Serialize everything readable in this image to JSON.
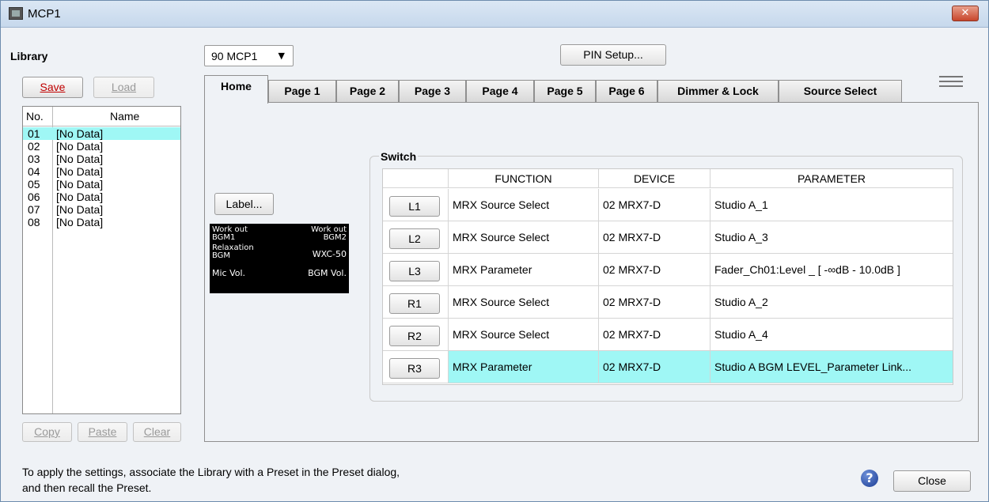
{
  "window": {
    "title": "MCP1",
    "close_glyph": "✕"
  },
  "library": {
    "heading": "Library",
    "save_label": "Save",
    "load_label": "Load",
    "copy_label": "Copy",
    "paste_label": "Paste",
    "clear_label": "Clear",
    "col_no": "No.",
    "col_name": "Name",
    "rows": [
      {
        "no": "01",
        "name": "[No Data]"
      },
      {
        "no": "02",
        "name": "[No Data]"
      },
      {
        "no": "03",
        "name": "[No Data]"
      },
      {
        "no": "04",
        "name": "[No Data]"
      },
      {
        "no": "05",
        "name": "[No Data]"
      },
      {
        "no": "06",
        "name": "[No Data]"
      },
      {
        "no": "07",
        "name": "[No Data]"
      },
      {
        "no": "08",
        "name": "[No Data]"
      }
    ],
    "selected_index": 0
  },
  "device_select": {
    "value": "90 MCP1",
    "arrow": "▼"
  },
  "pin_setup_label": "PIN Setup...",
  "tabs": [
    "Home",
    "Page 1",
    "Page 2",
    "Page 3",
    "Page 4",
    "Page 5",
    "Page 6",
    "Dimmer & Lock",
    "Source Select"
  ],
  "active_tab": "Home",
  "label_button": "Label...",
  "thumbnail": {
    "tl1": "Work out",
    "tl2": "BGM1",
    "tr1": "Work out",
    "tr2": "BGM2",
    "ml1": "Relaxation",
    "ml2": "BGM",
    "mr": "WXC-50",
    "bl": "Mic Vol.",
    "br": "BGM Vol."
  },
  "switch": {
    "title": "Switch",
    "headers": {
      "function": "FUNCTION",
      "device": "DEVICE",
      "parameter": "PARAMETER"
    },
    "rows": [
      {
        "key": "L1",
        "function": "MRX Source Select",
        "device": "02 MRX7-D",
        "parameter": "Studio A_1"
      },
      {
        "key": "L2",
        "function": "MRX Source Select",
        "device": "02 MRX7-D",
        "parameter": "Studio A_3"
      },
      {
        "key": "L3",
        "function": "MRX Parameter",
        "device": "02 MRX7-D",
        "parameter": "Fader_Ch01:Level _ [ -∞dB - 10.0dB ]"
      },
      {
        "key": "R1",
        "function": "MRX Source Select",
        "device": "02 MRX7-D",
        "parameter": "Studio A_2"
      },
      {
        "key": "R2",
        "function": "MRX Source Select",
        "device": "02 MRX7-D",
        "parameter": "Studio A_4"
      },
      {
        "key": "R3",
        "function": "MRX Parameter",
        "device": "02 MRX7-D",
        "parameter": "Studio A BGM LEVEL_Parameter Link..."
      }
    ],
    "selected_index": 5
  },
  "footer": {
    "line1": "To apply the settings, associate the Library with a Preset in the Preset dialog,",
    "line2": "and then recall the Preset.",
    "help_glyph": "?",
    "close_label": "Close"
  }
}
